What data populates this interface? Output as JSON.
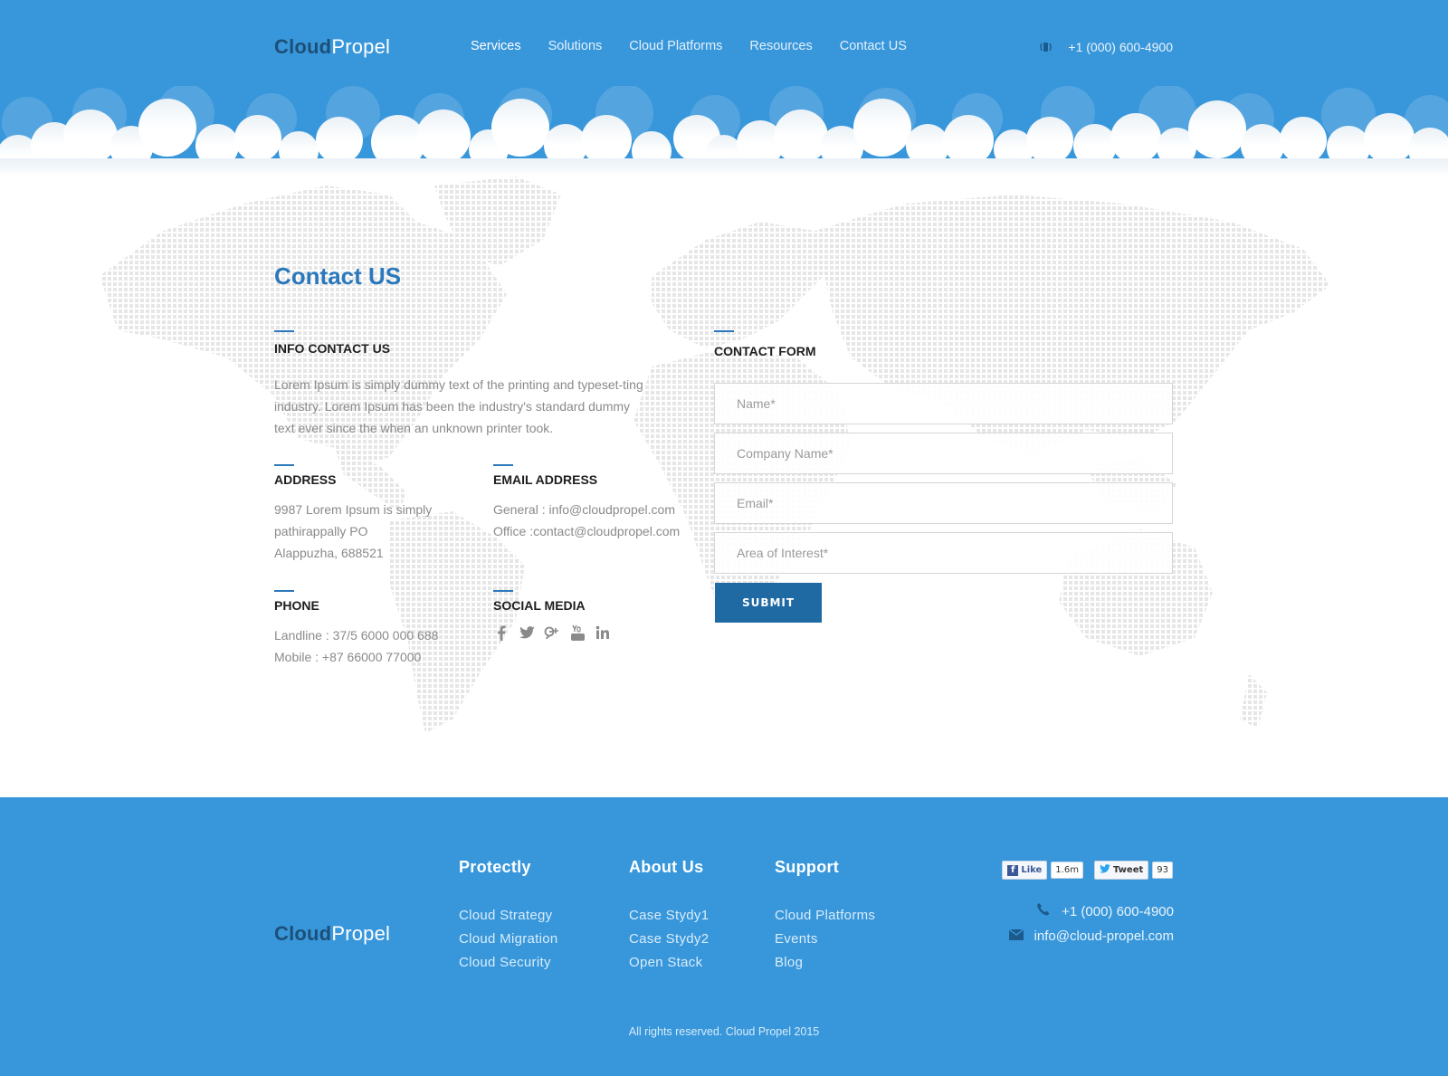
{
  "header": {
    "logo_part1": "Cloud",
    "logo_part2": "Propel",
    "nav": [
      "Services",
      "Solutions",
      "Cloud Platforms",
      "Resources",
      "Contact US"
    ],
    "active_nav": "Services",
    "phone": "+1 (000) 600-4900"
  },
  "contact": {
    "title": "Contact US",
    "info_heading": "INFO CONTACT US",
    "info_text": "Lorem Ipsum is simply dummy text of the printing and typeset-ting industry. Lorem Ipsum has been the industry's standard dummy text ever since the when an unknown printer took.",
    "address_heading": "ADDRESS",
    "address_lines": [
      "9987 Lorem Ipsum is simply",
      "pathirappally PO",
      "Alappuzha, 688521"
    ],
    "email_heading": "EMAIL ADDRESS",
    "email_lines": [
      "General : info@cloudpropel.com",
      "Office :contact@cloudpropel.com"
    ],
    "phone_heading": "PHONE",
    "phone_lines": [
      "Landline : 37/5 6000 000 688",
      "Mobile : +87 66000 77000"
    ],
    "social_heading": "SOCIAL MEDIA",
    "social_icons": [
      "facebook-icon",
      "twitter-icon",
      "google-plus-icon",
      "youtube-icon",
      "linkedin-icon"
    ],
    "form_heading": "CONTACT FORM",
    "form_placeholders": [
      "Name*",
      "Company Name*",
      "Email*",
      "Area of Interest*"
    ],
    "submit_label": "SUBMIT"
  },
  "footer": {
    "logo_part1": "Cloud",
    "logo_part2": "Propel",
    "columns": [
      {
        "title": "Protectly",
        "links": [
          "Cloud Strategy",
          "Cloud Migration",
          "Cloud Security"
        ]
      },
      {
        "title": "About Us",
        "links": [
          "Case Stydy1",
          "Case Stydy2",
          "Open Stack"
        ]
      },
      {
        "title": "Support",
        "links": [
          "Cloud Platforms",
          "Events",
          "Blog"
        ]
      }
    ],
    "like_label": "Like",
    "like_count": "1.6m",
    "tweet_label": "Tweet",
    "tweet_count": "93",
    "phone": "+1 (000) 600-4900",
    "email": "info@cloud-propel.com",
    "copyright": "All rights reserved. Cloud Propel 2015"
  },
  "colors": {
    "brand_blue": "#3897db",
    "accent_dark_blue": "#1f6aa3",
    "title_blue": "#2b78bb"
  }
}
